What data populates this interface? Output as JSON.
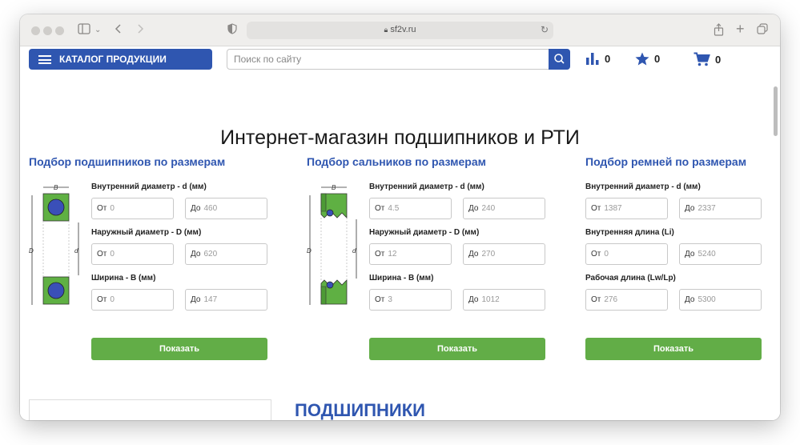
{
  "browser": {
    "url": "sf2v.ru"
  },
  "header": {
    "catalog_label": "КАТАЛОГ ПРОДУКЦИИ",
    "search_placeholder": "Поиск по сайту",
    "compare_count": "0",
    "favorites_count": "0",
    "cart_count": "0"
  },
  "page": {
    "title": "Интернет-магазин подшипников и РТИ",
    "section_heading": "ПОДШИПНИКИ"
  },
  "selectors": [
    {
      "title": "Подбор подшипников по размерам",
      "fields": [
        {
          "label": "Внутренний диаметр - d (мм)",
          "from_prefix": "От",
          "from_placeholder": "0",
          "to_prefix": "До",
          "to_placeholder": "460"
        },
        {
          "label": "Наружный диаметр - D (мм)",
          "from_prefix": "От",
          "from_placeholder": "0",
          "to_prefix": "До",
          "to_placeholder": "620"
        },
        {
          "label": "Ширина - B (мм)",
          "from_prefix": "От",
          "from_placeholder": "0",
          "to_prefix": "До",
          "to_placeholder": "147"
        }
      ],
      "button": "Показать"
    },
    {
      "title": "Подбор сальников по размерам",
      "fields": [
        {
          "label": "Внутренний диаметр - d (мм)",
          "from_prefix": "От",
          "from_placeholder": "4.5",
          "to_prefix": "До",
          "to_placeholder": "240"
        },
        {
          "label": "Наружный диаметр - D (мм)",
          "from_prefix": "От",
          "from_placeholder": "12",
          "to_prefix": "До",
          "to_placeholder": "270"
        },
        {
          "label": "Ширина - B (мм)",
          "from_prefix": "От",
          "from_placeholder": "3",
          "to_prefix": "До",
          "to_placeholder": "1012"
        }
      ],
      "button": "Показать"
    },
    {
      "title": "Подбор ремней по размерам",
      "fields": [
        {
          "label": "Внутренний диаметр - d (мм)",
          "from_prefix": "От",
          "from_placeholder": "1387",
          "to_prefix": "До",
          "to_placeholder": "2337"
        },
        {
          "label": "Внутренняя длина (Li)",
          "from_prefix": "От",
          "from_placeholder": "0",
          "to_prefix": "До",
          "to_placeholder": "5240"
        },
        {
          "label": "Рабочая длина (Lw/Lp)",
          "from_prefix": "От",
          "from_placeholder": "276",
          "to_prefix": "До",
          "to_placeholder": "5300"
        }
      ],
      "button": "Показать"
    }
  ],
  "diagram_labels": {
    "b": "B",
    "d_outer": "D",
    "d_inner": "d"
  },
  "colors": {
    "brand_blue": "#2f56b0",
    "button_green": "#62ad47",
    "ring_green": "#5fb043",
    "ball_blue": "#3a4fb8"
  },
  "icons": [
    "sidebar-icon",
    "back-icon",
    "forward-icon",
    "shield-icon",
    "lock-icon",
    "reload-icon",
    "share-icon",
    "new-tab-icon",
    "tabs-icon",
    "menu-icon",
    "search-icon",
    "compare-icon",
    "star-icon",
    "cart-icon"
  ]
}
